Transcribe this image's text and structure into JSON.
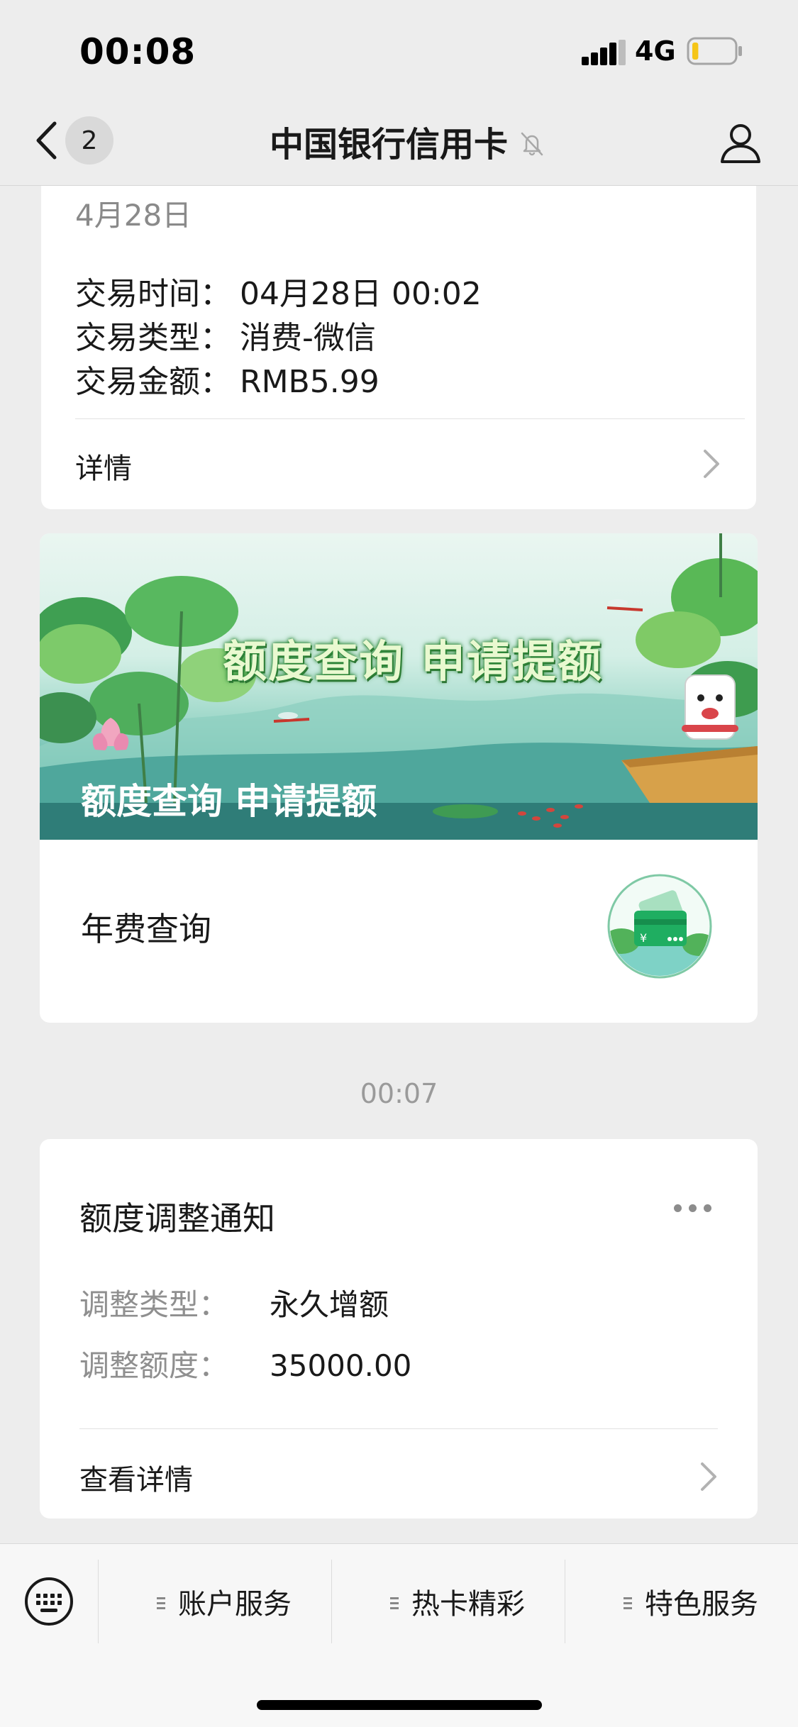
{
  "status_bar": {
    "time": "00:08",
    "network": "4G",
    "battery_level": 0.15,
    "battery_color": "#f5c518"
  },
  "nav": {
    "back_icon": "chevron-left-icon",
    "badge_count": "2",
    "title": "中国银行信用卡",
    "mute_icon": "bell-slash-icon",
    "profile_icon": "user-icon"
  },
  "transaction_card": {
    "date": "4月28日",
    "rows": [
      {
        "label": "交易时间：",
        "value": "04月28日 00:02"
      },
      {
        "label": "交易类型：",
        "value": "消费-微信"
      },
      {
        "label": "交易金额：",
        "value": "RMB5.99"
      }
    ],
    "detail_label": "详情"
  },
  "promo_card": {
    "banner_headline": "额度查询 申请提额",
    "banner_caption": "额度查询 申请提额",
    "item_label": "年费查询",
    "thumb_icon": "credit-card-yuan-icon"
  },
  "timestamp": "00:07",
  "limit_card": {
    "title": "额度调整通知",
    "rows": [
      {
        "label": "调整类型：",
        "value": "永久增额"
      },
      {
        "label": "调整额度：",
        "value": "35000.00"
      }
    ],
    "detail_label": "查看详情"
  },
  "bottom_menu": {
    "keyboard_icon": "keyboard-icon",
    "items": [
      {
        "label": "账户服务"
      },
      {
        "label": "热卡精彩"
      },
      {
        "label": "特色服务"
      }
    ]
  },
  "colors": {
    "background": "#ededed",
    "card": "#ffffff",
    "secondary_text": "#8f8f8f",
    "banner_green": "#3f8f88"
  }
}
